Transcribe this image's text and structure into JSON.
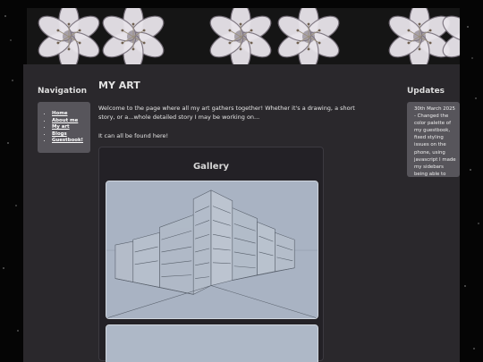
{
  "banner": {
    "image": "white-lily-flowers-banner",
    "colors": {
      "petal": "#e8e4ea",
      "shadow": "#7d7580",
      "background": "#151515"
    }
  },
  "nav": {
    "heading": "Navigation",
    "links": [
      "Home",
      "About me",
      "My art",
      "Blogs",
      "Guestbook!"
    ]
  },
  "main": {
    "title": "MY ART",
    "intro": "Welcome to the page where all my art gathers together! Whether it's a drawing, a short story, or a...whole detailed story I may be working on...",
    "found": "It can all be found here!",
    "gallery": {
      "title": "Gallery",
      "items": [
        {
          "image": "pencil-drawing-city-perspective"
        },
        {
          "image": "pencil-drawing-partial"
        }
      ]
    }
  },
  "updates": {
    "heading": "Updates",
    "text": "30th March 2025 - Changed the color palette of my guestbook, fixed styling issues on the phone, using javascript I made my sidebars being able to automatically"
  },
  "colors": {
    "page_bg": "#050505",
    "panel": "#2a282c",
    "sidebar_box": "#57555b",
    "gallery_bg": "#232126",
    "drawing_paper": "#aab4c4"
  }
}
